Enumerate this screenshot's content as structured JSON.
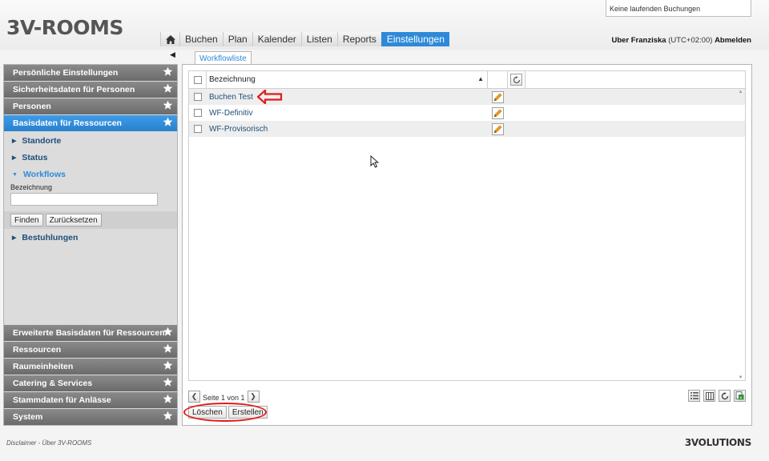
{
  "header": {
    "logo": "3V-ROOMS",
    "booking_status": "Keine laufenden Buchungen",
    "user_prefix": "Uber Franziska",
    "timezone": "(UTC+02:00)",
    "logout": "Abmelden"
  },
  "nav": {
    "home_icon": "home-icon",
    "items": [
      "Buchen",
      "Plan",
      "Kalender",
      "Listen",
      "Reports",
      "Einstellungen"
    ],
    "active": "Einstellungen"
  },
  "sidebar": {
    "top_sections": [
      "Persönliche Einstellungen",
      "Sicherheitsdaten für Personen",
      "Personen",
      "Basisdaten für Ressourcen"
    ],
    "active_section": "Basisdaten für Ressourcen",
    "sub_items": [
      "Standorte",
      "Status",
      "Workflows",
      "Bestuhlungen"
    ],
    "open_sub_item": "Workflows",
    "filter": {
      "label": "Bezeichnung",
      "value": "",
      "find_button": "Finden",
      "reset_button": "Zurücksetzen"
    },
    "bottom_sections": [
      "Erweiterte Basisdaten für Ressourcen",
      "Ressourcen",
      "Raumeinheiten",
      "Catering & Services",
      "Stammdaten für Anlässe",
      "System"
    ]
  },
  "main": {
    "tab": "Workflowliste",
    "grid": {
      "column_header": "Bezeichnung",
      "sort": "ascending",
      "rows": [
        "Buchen Test",
        "WF-Definitiv",
        "WF-Provisorisch"
      ]
    },
    "pager": {
      "text": "Seite 1 von 1"
    },
    "actions": {
      "delete": "Löschen",
      "create": "Erstellen"
    }
  },
  "footer": {
    "links": "Disclaimer  -  Über 3V-ROOMS",
    "brand": "3VOLUTIONS"
  },
  "colors": {
    "accent": "#2e8ad8",
    "section_header": "#7a7a7a",
    "annotation": "#e01b1b"
  }
}
